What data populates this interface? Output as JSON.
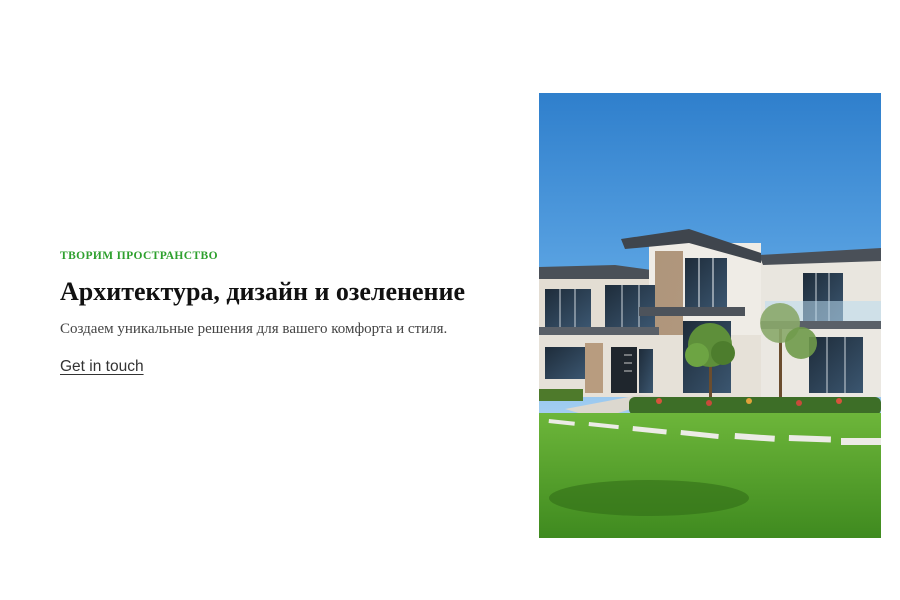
{
  "hero": {
    "eyebrow": "ТВОРИМ ПРОСТРАНСТВО",
    "headline": "Архитектура, дизайн и озеленение",
    "subtitle": "Создаем уникальные решения для вашего комфорта и стиля.",
    "cta_label": "Get in touch"
  },
  "image": {
    "alt": "modern-house-photo"
  },
  "colors": {
    "accent": "#2ea02e",
    "heading": "#111111",
    "body_text": "#444444",
    "sky": "#3f8fd6",
    "lawn": "#4f9e28"
  }
}
